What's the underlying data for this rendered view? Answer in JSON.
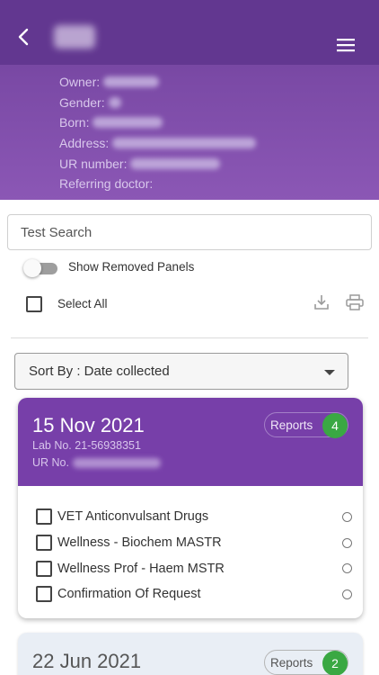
{
  "header": {
    "title": "",
    "back_icon": "chevron-left-icon",
    "menu_icon": "hamburger-menu-icon",
    "colors": {
      "topbar": "#623790",
      "gradient_end": "#8b57b5"
    }
  },
  "patient": {
    "owner_label": "Owner:",
    "gender_label": "Gender:",
    "born_label": "Born:",
    "address_label": "Address:",
    "ur_label": "UR number:",
    "referring_label": "Referring doctor:"
  },
  "search": {
    "placeholder": "Test Search"
  },
  "toggle": {
    "label": "Show Removed Panels",
    "on": false
  },
  "select_all": {
    "label": "Select All",
    "checked": false
  },
  "toolbar": {
    "download_icon": "download-icon",
    "print_icon": "print-icon"
  },
  "sort": {
    "label": "Sort By : Date collected"
  },
  "results": [
    {
      "date": "15 Nov 2021",
      "lab_no": "Lab No. 21-56938351",
      "ur_label": "UR No.",
      "reports_label": "Reports",
      "reports_count": "4",
      "panels": [
        {
          "name": "VET Anticonvulsant Drugs"
        },
        {
          "name": "Wellness - Biochem MASTR"
        },
        {
          "name": "Wellness Prof - Haem MSTR"
        },
        {
          "name": "Confirmation Of Request"
        }
      ]
    },
    {
      "date": "22 Jun 2021",
      "reports_label": "Reports",
      "reports_count": "2"
    }
  ],
  "colors": {
    "card_header": "#773fa9",
    "badge": "#3aa843"
  }
}
